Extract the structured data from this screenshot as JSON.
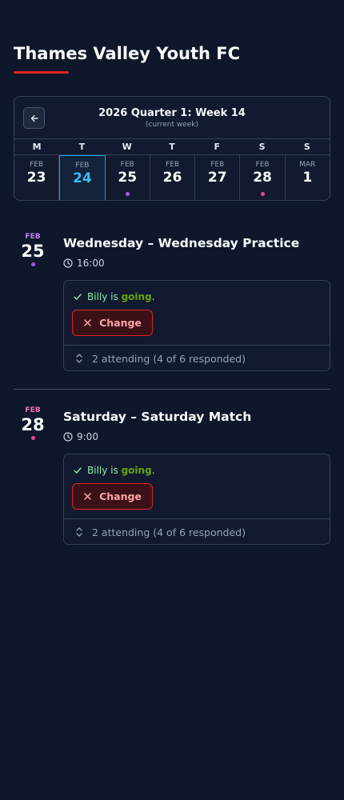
{
  "header": {
    "title": "Thames Valley Youth FC"
  },
  "calendar": {
    "title": "2026 Quarter 1: Week 14",
    "subtitle": "(current week)",
    "weekdays": [
      "M",
      "T",
      "W",
      "T",
      "F",
      "S",
      "S"
    ],
    "days": [
      {
        "month": "FEB",
        "day": "23"
      },
      {
        "month": "FEB",
        "day": "24"
      },
      {
        "month": "FEB",
        "day": "25"
      },
      {
        "month": "FEB",
        "day": "26"
      },
      {
        "month": "FEB",
        "day": "27"
      },
      {
        "month": "FEB",
        "day": "28"
      },
      {
        "month": "MAR",
        "day": "1"
      }
    ],
    "colors": {
      "selected": "#38bdf8",
      "practice_dot": "#a855f7",
      "match_dot": "#ec4899"
    }
  },
  "events": [
    {
      "month": "FEB",
      "day": "25",
      "title": "Wednesday – Wednesday Practice",
      "time": "16:00",
      "status_prefix": "Billy is ",
      "status_value": "going",
      "status_suffix": ".",
      "change_label": "Change",
      "attendance": "2 attending (4 of 6 responded)",
      "accent": "#c084fc"
    },
    {
      "month": "FEB",
      "day": "28",
      "title": "Saturday – Saturday Match",
      "time": "9:00",
      "status_prefix": "Billy is ",
      "status_value": "going",
      "status_suffix": ".",
      "change_label": "Change",
      "attendance": "2 attending (4 of 6 responded)",
      "accent": "#f472b6"
    }
  ],
  "icons": {
    "back": "arrow-left-icon",
    "clock": "clock-icon",
    "check": "check-icon",
    "close": "x-icon",
    "expand": "chevron-up-down-icon"
  }
}
